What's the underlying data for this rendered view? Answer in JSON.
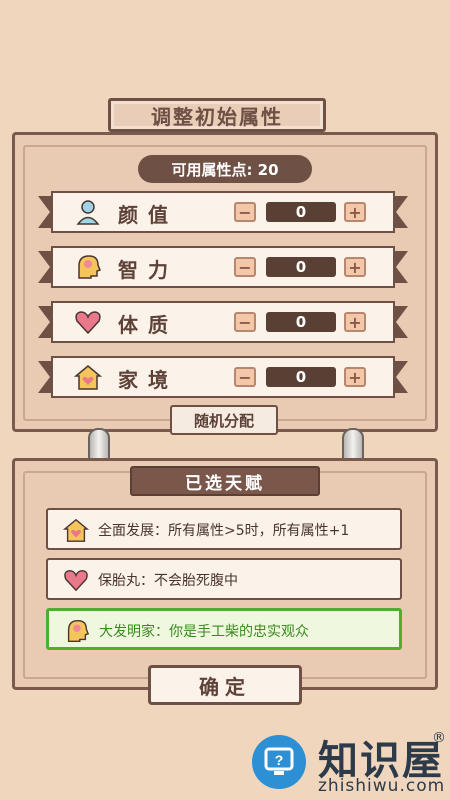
{
  "header": {
    "title": "调整初始属性"
  },
  "points": {
    "label": "可用属性点: 20"
  },
  "attributes": [
    {
      "name": "颜值",
      "icon": "face-person-icon",
      "value": "0",
      "minus": "−",
      "plus": "+"
    },
    {
      "name": "智力",
      "icon": "head-brain-icon",
      "value": "0",
      "minus": "−",
      "plus": "+"
    },
    {
      "name": "体质",
      "icon": "heart-icon",
      "value": "0",
      "minus": "−",
      "plus": "+"
    },
    {
      "name": "家境",
      "icon": "house-icon",
      "value": "0",
      "minus": "−",
      "plus": "+"
    }
  ],
  "random_button": "随机分配",
  "talents_title": "已选天赋",
  "talents": [
    {
      "text": "全面发展：所有属性>5时，所有属性+1",
      "icon": "house-icon",
      "selected": false
    },
    {
      "text": "保胎丸：不会胎死腹中",
      "icon": "heart-icon",
      "selected": false
    },
    {
      "text": "大发明家：你是手工柴的忠实观众",
      "icon": "head-brain-icon",
      "selected": true
    }
  ],
  "confirm_button": "确定",
  "watermark": {
    "title": "知识屋",
    "url": "zhishiwu.com",
    "reg": "®"
  },
  "colors": {
    "background": "#f0d6bd",
    "dark_brown": "#6e5045",
    "selected_green": "#4caf2d",
    "watermark_blue": "#2d8fd4"
  }
}
